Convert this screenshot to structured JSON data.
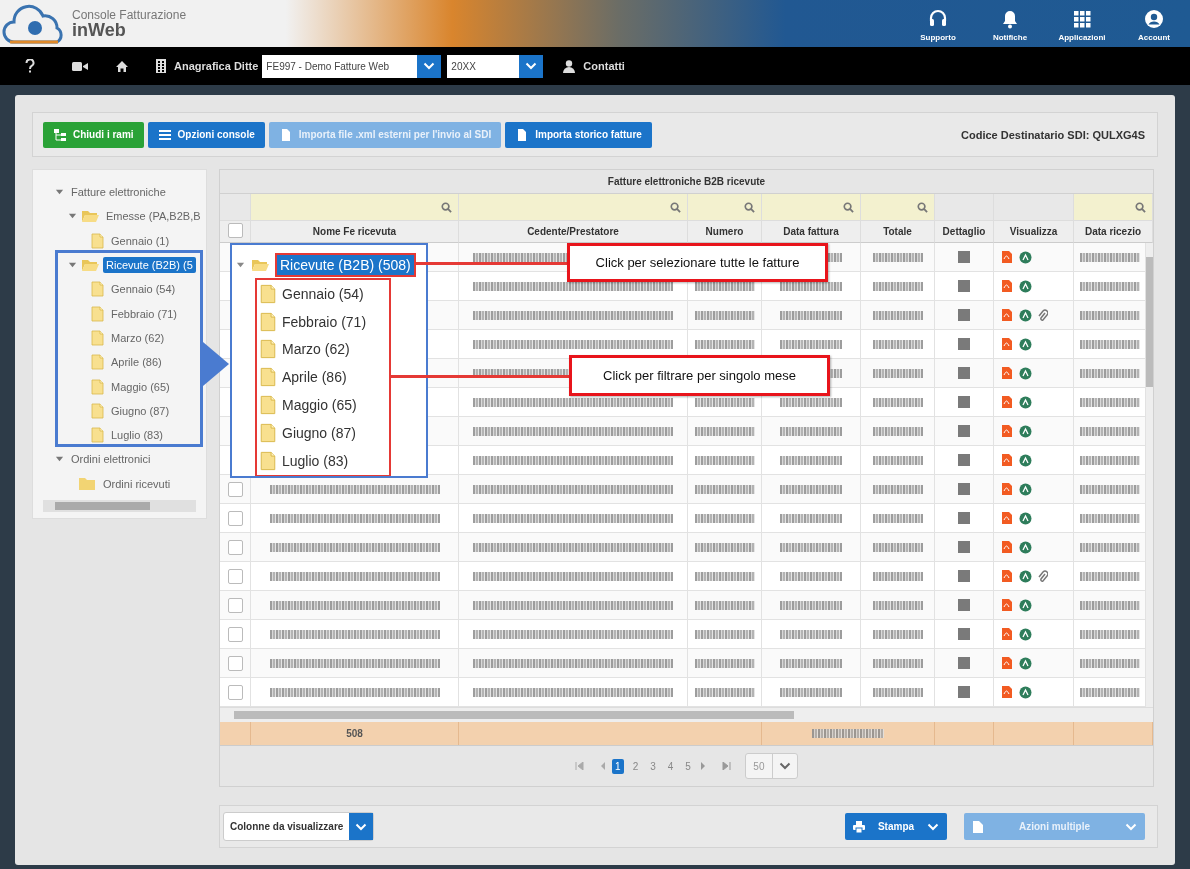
{
  "header": {
    "app_title": "Console Fatturazione",
    "app_name": "inWeb",
    "actions": [
      {
        "label": "Supporto",
        "kind": "headset"
      },
      {
        "label": "Notifiche",
        "kind": "bell"
      },
      {
        "label": "Applicazioni",
        "kind": "grid"
      },
      {
        "label": "Account",
        "kind": "user"
      }
    ]
  },
  "nav": {
    "company_label": "Anagrafica Ditte",
    "company": "FE997 - Demo Fatture Web",
    "year": "20XX",
    "contacts": "Contatti"
  },
  "toolbar": {
    "buttons": [
      {
        "label": "Chiudi i rami",
        "kind": "tree",
        "disabled": false
      },
      {
        "label": "Opzioni console",
        "kind": "list",
        "disabled": false
      },
      {
        "label": "Importa file .xml esterni per l'invio al SDI",
        "kind": "file",
        "disabled": true
      },
      {
        "label": "Importa storico fatture",
        "kind": "file",
        "disabled": false
      }
    ],
    "recipient_code": "Codice Destinatario SDI: QULXG4S"
  },
  "tree": [
    {
      "label": "Fatture elettroniche",
      "kind": "group",
      "expanded": true,
      "selected": false,
      "children": [
        {
          "label": "Emesse (PA,B2B,B",
          "kind": "folder",
          "expanded": true,
          "selected": false,
          "children": [
            {
              "label": "Gennaio (1)",
              "kind": "month",
              "selected": false
            }
          ]
        },
        {
          "label": "Ricevute (B2B) (5",
          "kind": "folder",
          "expanded": true,
          "selected": true,
          "children": [
            {
              "label": "Gennaio (54)",
              "kind": "month",
              "selected": false
            },
            {
              "label": "Febbraio (71)",
              "kind": "month",
              "selected": false
            },
            {
              "label": "Marzo (62)",
              "kind": "month",
              "selected": false
            },
            {
              "label": "Aprile (86)",
              "kind": "month",
              "selected": false
            },
            {
              "label": "Maggio (65)",
              "kind": "month",
              "selected": false
            },
            {
              "label": "Giugno (87)",
              "kind": "month",
              "selected": false
            },
            {
              "label": "Luglio (83)",
              "kind": "month",
              "selected": false
            }
          ]
        }
      ]
    },
    {
      "label": "Ordini elettronici",
      "kind": "group",
      "expanded": true,
      "selected": false,
      "children": [
        {
          "label": "Ordini ricevuti",
          "kind": "folder",
          "selected": false
        }
      ]
    }
  ],
  "table": {
    "title": "Fatture elettroniche B2B ricevute",
    "select_all_checked": false,
    "columns": [
      {
        "label": "Nome Fe ricevuta",
        "filter": true
      },
      {
        "label": "Cedente/Prestatore",
        "filter": true
      },
      {
        "label": "Numero",
        "filter": true
      },
      {
        "label": "Data fattura",
        "filter": true
      },
      {
        "label": "Totale",
        "filter": true
      },
      {
        "label": "Dettaglio",
        "filter": false
      },
      {
        "label": "Visualizza",
        "filter": false
      },
      {
        "label": "Data ricezio",
        "filter": true
      }
    ],
    "rows": [
      {
        "covered": true,
        "attachment": false
      },
      {
        "covered": true,
        "attachment": false
      },
      {
        "covered": true,
        "attachment": true
      },
      {
        "covered": true,
        "attachment": false
      },
      {
        "covered": true,
        "attachment": false
      },
      {
        "covered": true,
        "attachment": false
      },
      {
        "covered": true,
        "attachment": false
      },
      {
        "covered": true,
        "attachment": false
      },
      {
        "covered": false,
        "attachment": false,
        "checked": false
      },
      {
        "covered": false,
        "attachment": false,
        "checked": false
      },
      {
        "covered": false,
        "attachment": false,
        "checked": false
      },
      {
        "covered": false,
        "attachment": true,
        "checked": false
      },
      {
        "covered": false,
        "attachment": false,
        "checked": false
      },
      {
        "covered": false,
        "attachment": false,
        "checked": false
      },
      {
        "covered": false,
        "attachment": false,
        "checked": false
      },
      {
        "covered": false,
        "attachment": false,
        "checked": false
      }
    ],
    "footer": {
      "count": "508"
    }
  },
  "pagination": {
    "pages": [
      {
        "label": "1",
        "selected": true
      },
      {
        "label": "2",
        "selected": false
      },
      {
        "label": "3",
        "selected": false
      },
      {
        "label": "4",
        "selected": false
      },
      {
        "label": "5",
        "selected": false
      }
    ],
    "page_size": "50"
  },
  "bottom": {
    "columns_select": "Colonne da visualizzare",
    "print": "Stampa",
    "bulk_actions": "Azioni multiple",
    "bulk_disabled": true
  },
  "callout": {
    "root": {
      "label": "Ricevute (B2B) (508)",
      "selected": true,
      "expanded": true
    },
    "months": [
      "Gennaio (54)",
      "Febbraio (71)",
      "Marzo (62)",
      "Aprile (86)",
      "Maggio (65)",
      "Giugno (87)",
      "Luglio (83)"
    ],
    "notes": [
      "Click per selezionare tutte le fatture",
      "Click per filtrare per singolo mese"
    ]
  }
}
